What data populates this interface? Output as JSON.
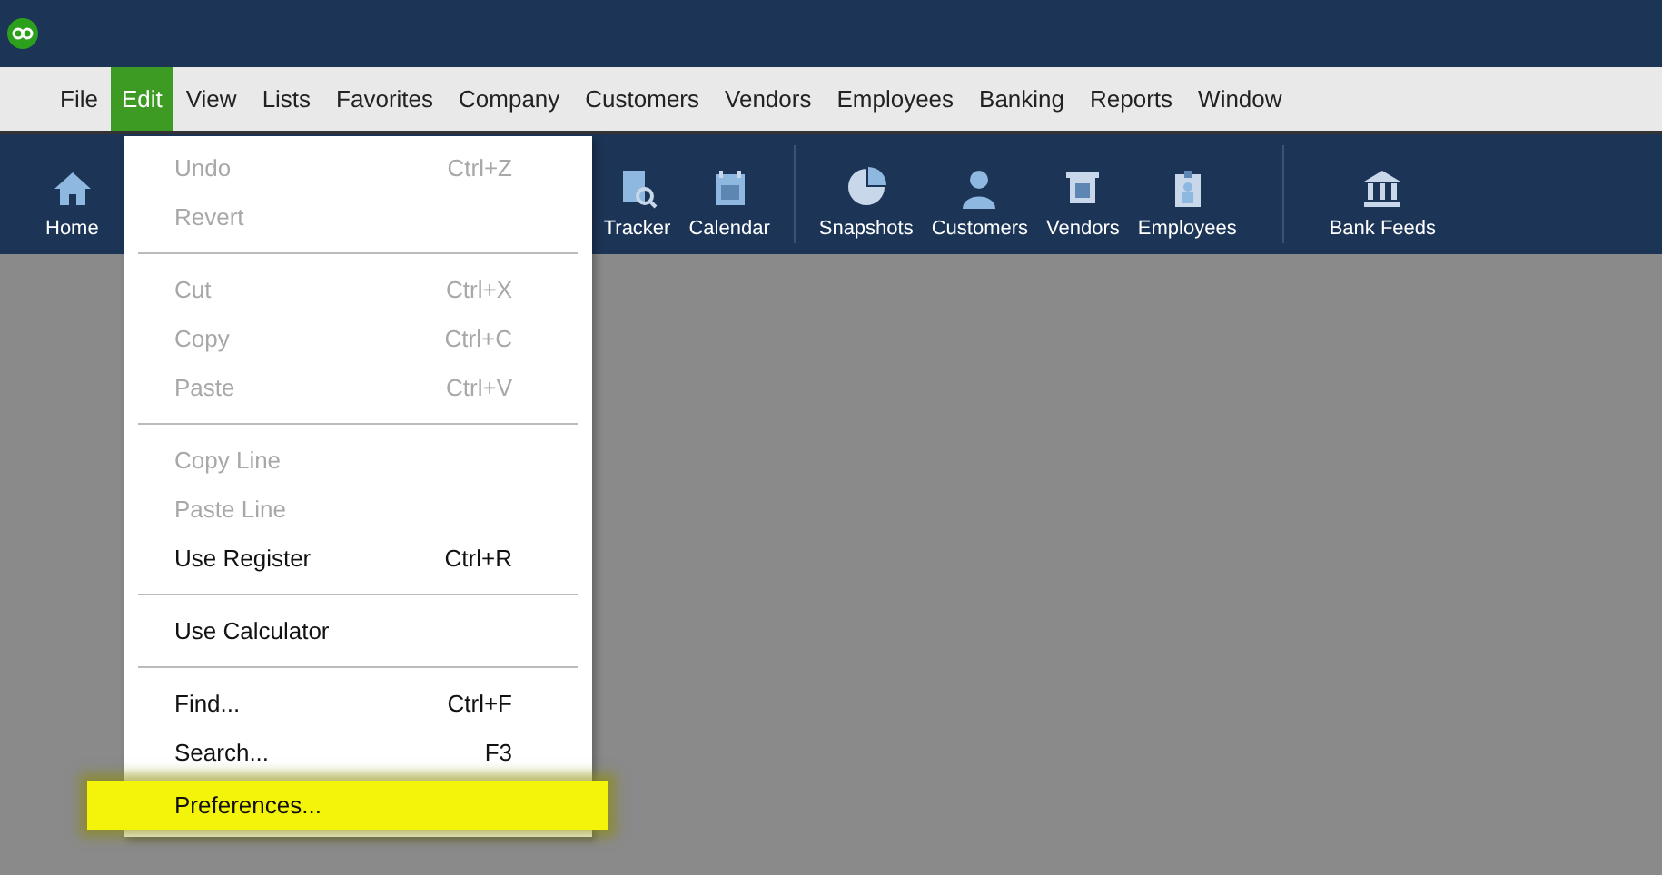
{
  "menu_bar": [
    {
      "label": "File",
      "selected": false
    },
    {
      "label": "Edit",
      "selected": true
    },
    {
      "label": "View",
      "selected": false
    },
    {
      "label": "Lists",
      "selected": false
    },
    {
      "label": "Favorites",
      "selected": false
    },
    {
      "label": "Company",
      "selected": false
    },
    {
      "label": "Customers",
      "selected": false
    },
    {
      "label": "Vendors",
      "selected": false
    },
    {
      "label": "Employees",
      "selected": false
    },
    {
      "label": "Banking",
      "selected": false
    },
    {
      "label": "Reports",
      "selected": false
    },
    {
      "label": "Window",
      "selected": false
    }
  ],
  "toolbar": [
    {
      "label": "Home",
      "kind": "home"
    },
    {
      "label": "Tracker",
      "kind": "tracker"
    },
    {
      "label": "Calendar",
      "kind": "calendar"
    },
    {
      "label": "Snapshots",
      "kind": "snapshots"
    },
    {
      "label": "Customers",
      "kind": "customers"
    },
    {
      "label": "Vendors",
      "kind": "vendors"
    },
    {
      "label": "Employees",
      "kind": "employees"
    },
    {
      "label": "Bank Feeds",
      "kind": "bank"
    }
  ],
  "edit_menu": [
    {
      "kind": "item",
      "label": "Undo",
      "shortcut": "Ctrl+Z",
      "disabled": true,
      "highlighted": false
    },
    {
      "kind": "item",
      "label": "Revert",
      "disabled": true,
      "highlighted": false
    },
    {
      "kind": "separator"
    },
    {
      "kind": "item",
      "label": "Cut",
      "shortcut": "Ctrl+X",
      "disabled": true,
      "highlighted": false
    },
    {
      "kind": "item",
      "label": "Copy",
      "shortcut": "Ctrl+C",
      "disabled": true,
      "highlighted": false
    },
    {
      "kind": "item",
      "label": "Paste",
      "shortcut": "Ctrl+V",
      "disabled": true,
      "highlighted": false
    },
    {
      "kind": "separator"
    },
    {
      "kind": "item",
      "label": "Copy Line",
      "disabled": true,
      "highlighted": false
    },
    {
      "kind": "item",
      "label": "Paste Line",
      "disabled": true,
      "highlighted": false
    },
    {
      "kind": "item",
      "label": "Use Register",
      "shortcut": "Ctrl+R",
      "disabled": false,
      "highlighted": false
    },
    {
      "kind": "separator"
    },
    {
      "kind": "item",
      "label": "Use Calculator",
      "disabled": false,
      "highlighted": false
    },
    {
      "kind": "separator"
    },
    {
      "kind": "item",
      "label": "Find...",
      "shortcut": "Ctrl+F",
      "disabled": false,
      "highlighted": false
    },
    {
      "kind": "item",
      "label": "Search...",
      "shortcut": "F3",
      "disabled": false,
      "highlighted": false
    },
    {
      "kind": "item",
      "label": "Preferences...",
      "disabled": false,
      "highlighted": true
    }
  ]
}
